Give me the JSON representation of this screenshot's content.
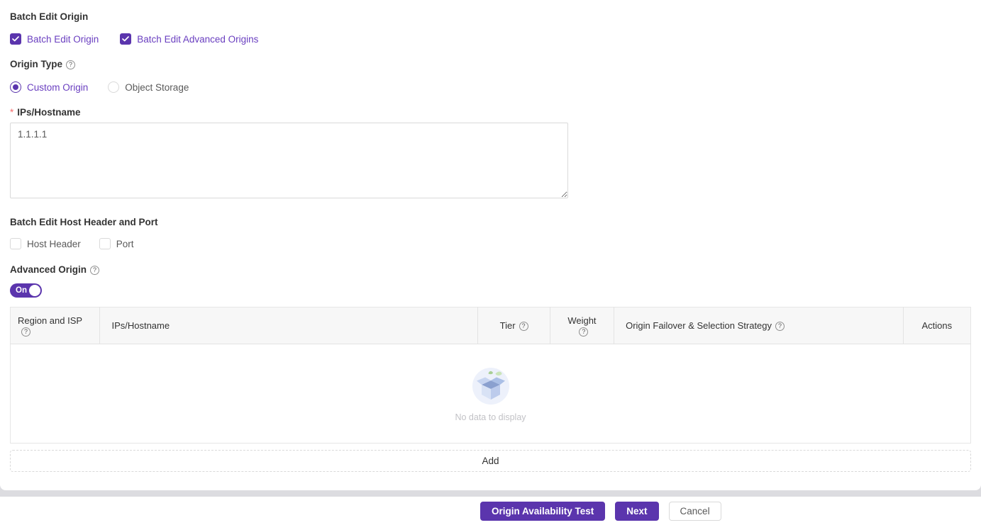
{
  "colors": {
    "accent_fill": "#5b35ad",
    "accent_text": "#6a3fc0",
    "required_mark": "#f56c6c",
    "header_bg": "#f7f7f7",
    "page_band": "#dcdce0"
  },
  "icons": {
    "help": "?"
  },
  "batch_edit_origin": {
    "title": "Batch Edit Origin",
    "checkboxes": [
      {
        "label": "Batch Edit Origin",
        "checked": true
      },
      {
        "label": "Batch Edit Advanced Origins",
        "checked": true
      }
    ]
  },
  "origin_type": {
    "label": "Origin Type",
    "options": [
      {
        "label": "Custom Origin",
        "selected": true
      },
      {
        "label": "Object Storage",
        "selected": false
      }
    ]
  },
  "ips_hostname": {
    "required_mark": "*",
    "label": "IPs/Hostname",
    "value": "1.1.1.1"
  },
  "host_header_port": {
    "title": "Batch Edit Host Header and Port",
    "checkboxes": [
      {
        "label": "Host Header",
        "checked": false
      },
      {
        "label": "Port",
        "checked": false
      }
    ]
  },
  "advanced_origin": {
    "label": "Advanced Origin",
    "toggle_state": "On"
  },
  "origins_table": {
    "columns": [
      {
        "label": "Region and ISP",
        "help": true
      },
      {
        "label": "IPs/Hostname",
        "help": false
      },
      {
        "label": "Tier",
        "help": true
      },
      {
        "label": "Weight",
        "help": true
      },
      {
        "label": "Origin Failover & Selection Strategy",
        "help": true
      },
      {
        "label": "Actions",
        "help": false
      }
    ],
    "empty_text": "No data to display",
    "add_label": "Add"
  },
  "footer": {
    "buttons": [
      {
        "label": "Origin Availability Test",
        "style": "primary"
      },
      {
        "label": "Next",
        "style": "primary"
      },
      {
        "label": "Cancel",
        "style": "default"
      }
    ]
  }
}
